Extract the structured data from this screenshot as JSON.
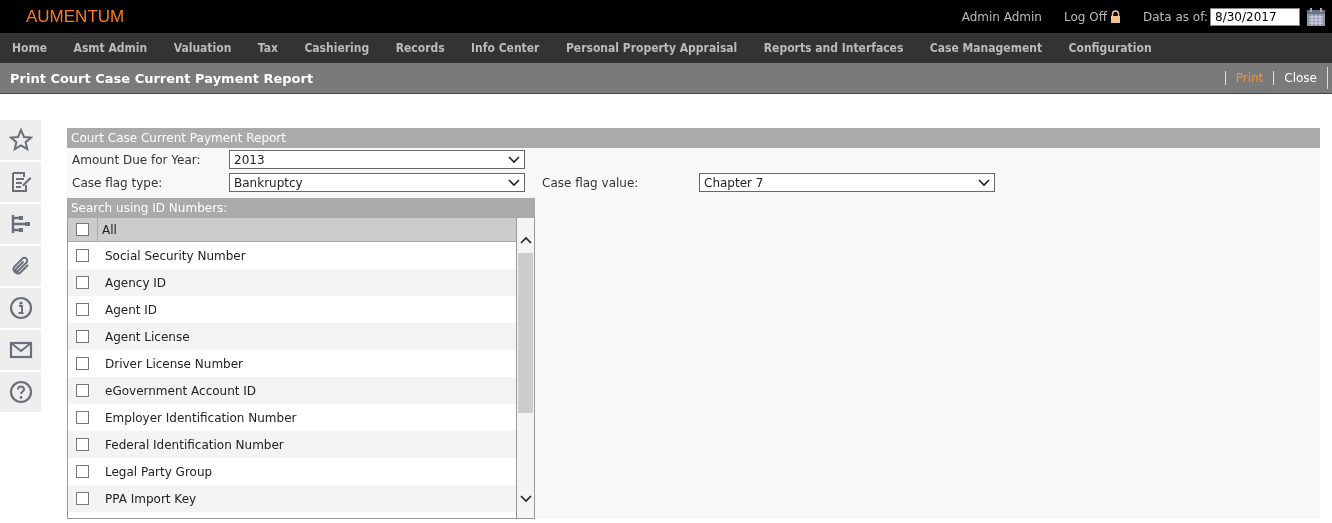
{
  "brand": "AUMENTUM",
  "user": "Admin Admin",
  "logoff": "Log Off",
  "data_as_of": {
    "label": "Data as of:",
    "value": "8/30/2017"
  },
  "menu": [
    "Home",
    "Asmt Admin",
    "Valuation",
    "Tax",
    "Cashiering",
    "Records",
    "Info Center",
    "Personal Property Appraisal",
    "Reports and Interfaces",
    "Case Management",
    "Configuration"
  ],
  "page_title": "Print Court Case Current Payment Report",
  "actions": [
    {
      "label": "Print",
      "kind": "primary"
    },
    {
      "label": "Close",
      "kind": "plain"
    }
  ],
  "panel": {
    "title": "Court Case Current Payment Report",
    "amount_due": {
      "label": "Amount Due for Year:",
      "value": "2013"
    },
    "flag_type": {
      "label": "Case flag type:",
      "value": "Bankruptcy"
    },
    "flag_value": {
      "label": "Case flag value:",
      "value": "Chapter 7"
    },
    "id_search": {
      "title": "Search using ID Numbers:",
      "all": {
        "label": "All",
        "checked": false
      },
      "items": [
        {
          "label": "Social Security Number",
          "checked": false
        },
        {
          "label": "Agency ID",
          "checked": false
        },
        {
          "label": "Agent ID",
          "checked": false
        },
        {
          "label": "Agent License",
          "checked": false
        },
        {
          "label": "Driver License Number",
          "checked": false
        },
        {
          "label": "eGovernment Account ID",
          "checked": false
        },
        {
          "label": "Employer Identification Number",
          "checked": false
        },
        {
          "label": "Federal Identification Number",
          "checked": false
        },
        {
          "label": "Legal Party Group",
          "checked": false
        },
        {
          "label": "PPA Import Key",
          "checked": false
        }
      ]
    }
  }
}
